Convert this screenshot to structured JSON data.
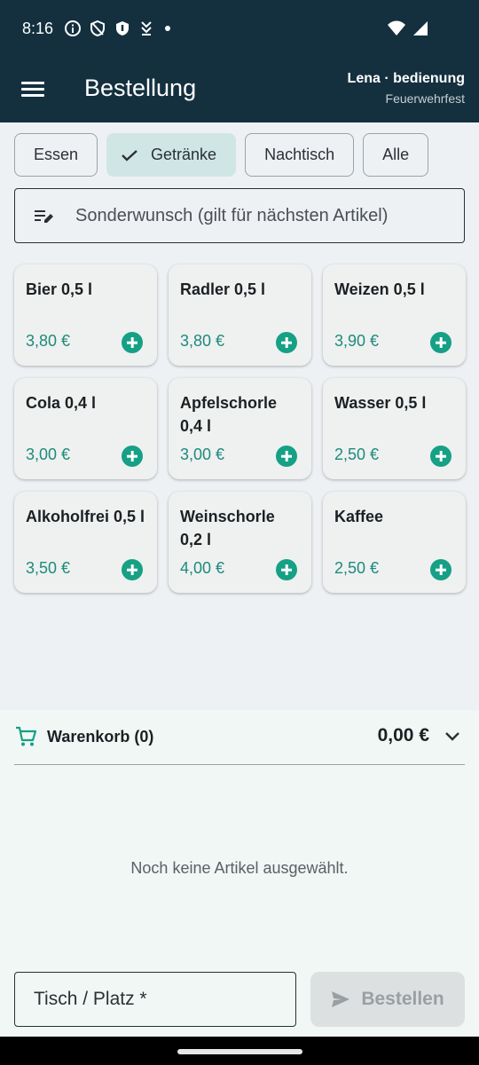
{
  "status_bar": {
    "time": "8:16",
    "icons": [
      "info-icon",
      "shield-outline-icon",
      "shield-filled-icon",
      "download-arrows-icon",
      "dot-icon",
      "wifi-icon",
      "signal-icon"
    ]
  },
  "app_bar": {
    "title": "Bestellung",
    "user": "Lena · bedienung",
    "event": "Feuerwehrfest"
  },
  "categories": [
    {
      "label": "Essen",
      "selected": false
    },
    {
      "label": "Getränke",
      "selected": true
    },
    {
      "label": "Nachtisch",
      "selected": false
    },
    {
      "label": "Alle",
      "selected": false
    }
  ],
  "special_request": {
    "placeholder": "Sonderwunsch (gilt für nächsten Artikel)"
  },
  "products": [
    {
      "name": "Bier 0,5 l",
      "price": "3,80 €"
    },
    {
      "name": "Radler 0,5 l",
      "price": "3,80 €"
    },
    {
      "name": "Weizen 0,5 l",
      "price": "3,90 €"
    },
    {
      "name": "Cola 0,4 l",
      "price": "3,00 €"
    },
    {
      "name": "Apfelschorle 0,4 l",
      "price": "3,00 €"
    },
    {
      "name": "Wasser 0,5 l",
      "price": "2,50 €"
    },
    {
      "name": "Alkoholfrei 0,5 l",
      "price": "3,50 €"
    },
    {
      "name": "Weinschorle 0,2 l",
      "price": "4,00 €"
    },
    {
      "name": "Kaffee",
      "price": "2,50 €"
    }
  ],
  "cart": {
    "label": "Warenkorb (0)",
    "total": "0,00 €",
    "empty_message": "Noch keine Artikel ausgewählt."
  },
  "order_form": {
    "table_placeholder": "Tisch / Platz *",
    "submit_label": "Bestellen"
  },
  "colors": {
    "app_bar": "#14303f",
    "accent": "#16a085",
    "price": "#1f8a7c",
    "chip_selected": "#cfe6e5"
  }
}
